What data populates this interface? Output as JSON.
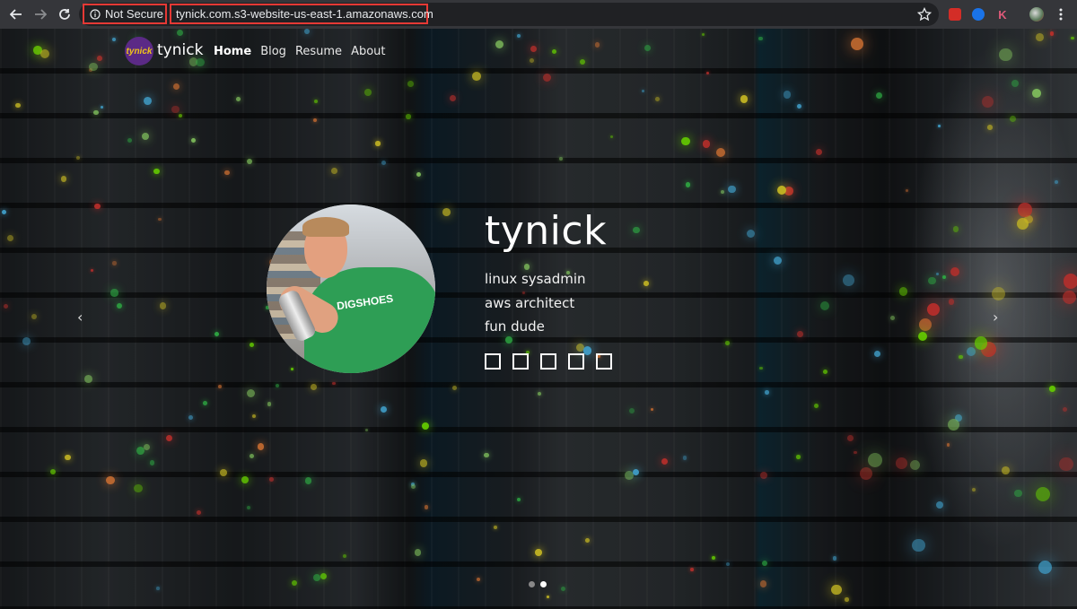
{
  "browser": {
    "security_label": "Not Secure",
    "url": "tynick.com.s3-website-us-east-1.amazonaws.com"
  },
  "icons": {
    "back": "back-arrow-icon",
    "forward": "forward-arrow-icon",
    "reload": "reload-icon",
    "info": "info-icon",
    "star": "star-icon",
    "menu": "kebab-menu-icon"
  },
  "site": {
    "logo_text": "tynick",
    "brand": "tynick",
    "nav": [
      {
        "label": "Home",
        "active": true
      },
      {
        "label": "Blog",
        "active": false
      },
      {
        "label": "Resume",
        "active": false
      },
      {
        "label": "About",
        "active": false
      }
    ]
  },
  "hero": {
    "title": "tynick",
    "lines": [
      "linux sysadmin",
      "aws architect",
      "fun dude"
    ],
    "portrait_shirt_text": "DIGSHOES",
    "social_count": 5,
    "prev_arrow": "‹",
    "next_arrow": "›",
    "slides": 2,
    "active_slide": 1
  },
  "colors": {
    "highlight": "#e53935",
    "chrome": "#35363a",
    "logo_bg": "#5b2a86",
    "logo_text": "#f0c419"
  }
}
